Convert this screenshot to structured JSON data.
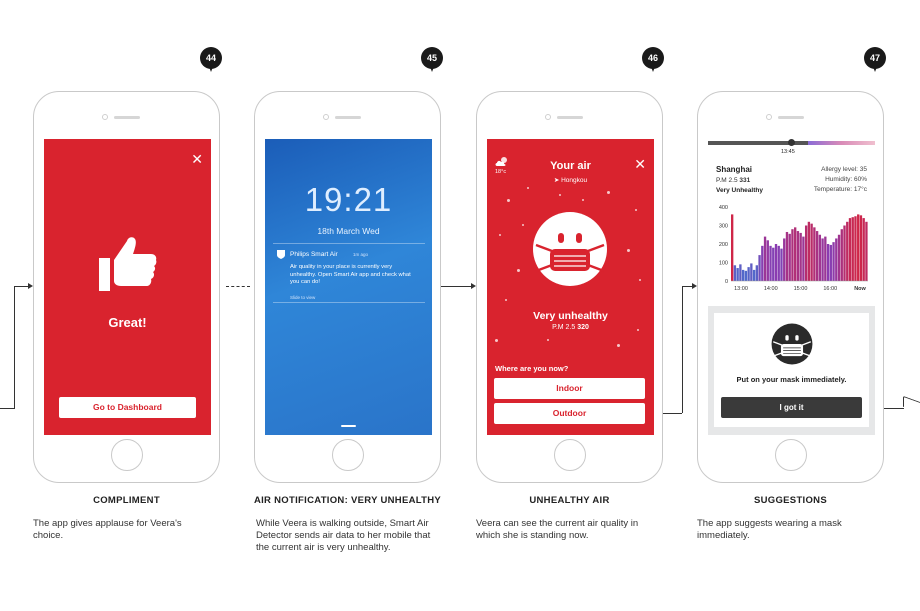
{
  "steps": [
    {
      "number": "44",
      "title": "COMPLIMENT",
      "description": "The app gives applause for Veera's choice.",
      "screen": {
        "headline": "Great!",
        "button_label": "Go to Dashboard",
        "close_glyph": "✕",
        "icon": "thumbs-up-icon"
      }
    },
    {
      "number": "45",
      "title": "AIR NOTIFICATION: VERY UNHEALTHY",
      "description": "While Veera is walking outside, Smart Air Detector sends air data to her mobile that the current air is very unhealthy.",
      "screen": {
        "clock": "19:21",
        "date": "18th March Wed",
        "notification_app": "Philips Smart Air",
        "notification_time": "1m ago",
        "notification_body": "Air quality in your place is currently very unhealthy. Open Smart Air app and check what you can do!",
        "notification_hint": "Slide to view"
      }
    },
    {
      "number": "46",
      "title": "UNHEALTHY AIR",
      "description": "Veera can see the current air quality in which she is standing now.",
      "screen": {
        "title": "Your air",
        "location": "Hongkou",
        "temperature": "18°c",
        "status": "Very unhealthy",
        "pm_label": "P.M 2.5",
        "pm_value": "320",
        "question": "Where are you now?",
        "options": [
          "Indoor",
          "Outdoor"
        ],
        "close_glyph": "✕",
        "icon": "masked-face-icon"
      }
    },
    {
      "number": "47",
      "title": "SUGGESTIONS",
      "description": "The app suggests wearing a mask immediately.",
      "screen": {
        "slider_time": "13:45",
        "city": "Shanghai",
        "pm_label": "P.M 2.5",
        "pm_value": "331",
        "status": "Very Unhealthy",
        "allergy": "Allergy level: 35",
        "humidity": "Humidity: 60%",
        "temperature": "Temperature: 17°c",
        "tip": "Put on your mask immediately.",
        "button_label": "I got it",
        "icon": "masked-face-icon"
      }
    }
  ],
  "chart_data": {
    "type": "bar",
    "title": "",
    "xlabel": "",
    "ylabel": "",
    "ylim": [
      0,
      400
    ],
    "y_ticks": [
      "400",
      "300",
      "200",
      "100",
      "0"
    ],
    "x_ticks": [
      "13:00",
      "14:00",
      "15:00",
      "16:00",
      "Now"
    ],
    "values": [
      360,
      85,
      70,
      90,
      60,
      55,
      75,
      95,
      60,
      85,
      140,
      190,
      240,
      220,
      190,
      180,
      200,
      190,
      175,
      230,
      265,
      255,
      280,
      290,
      270,
      260,
      240,
      300,
      320,
      310,
      290,
      270,
      250,
      230,
      240,
      200,
      195,
      210,
      230,
      250,
      280,
      300,
      320,
      340,
      345,
      350,
      360,
      355,
      340,
      320
    ],
    "colors_note": "bars shift from blue (low) through purple to red (high)",
    "colors": {
      "low": "#3a7bd5",
      "mid": "#8a3cb0",
      "high": "#e0202e"
    }
  }
}
